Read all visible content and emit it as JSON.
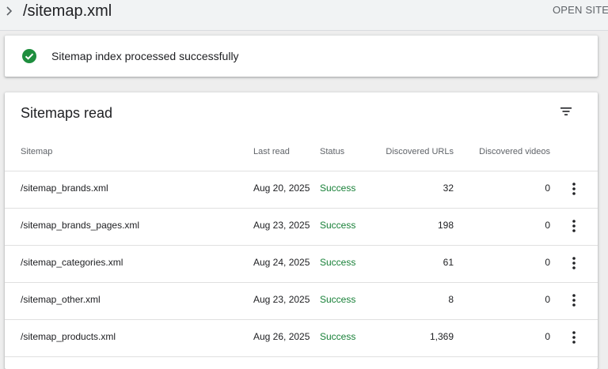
{
  "header": {
    "title": "/sitemap.xml",
    "open_label": "OPEN SITEMAP"
  },
  "status_card": {
    "message": "Sitemap index processed successfully",
    "icon": "check-circle-icon",
    "icon_color": "#1e8e3e"
  },
  "sitemaps_card": {
    "title": "Sitemaps read",
    "columns": {
      "sitemap": "Sitemap",
      "last_read": "Last read",
      "status": "Status",
      "discovered_urls": "Discovered URLs",
      "discovered_videos": "Discovered videos"
    },
    "rows": [
      {
        "sitemap": "/sitemap_brands.xml",
        "last_read": "Aug 20, 2025",
        "status": "Success",
        "urls": "32",
        "videos": "0"
      },
      {
        "sitemap": "/sitemap_brands_pages.xml",
        "last_read": "Aug 23, 2025",
        "status": "Success",
        "urls": "198",
        "videos": "0"
      },
      {
        "sitemap": "/sitemap_categories.xml",
        "last_read": "Aug 24, 2025",
        "status": "Success",
        "urls": "61",
        "videos": "0"
      },
      {
        "sitemap": "/sitemap_other.xml",
        "last_read": "Aug 23, 2025",
        "status": "Success",
        "urls": "8",
        "videos": "0"
      },
      {
        "sitemap": "/sitemap_products.xml",
        "last_read": "Aug 26, 2025",
        "status": "Success",
        "urls": "1,369",
        "videos": "0"
      }
    ]
  },
  "colors": {
    "success": "#188038",
    "text": "#202124",
    "muted": "#5f6368"
  }
}
